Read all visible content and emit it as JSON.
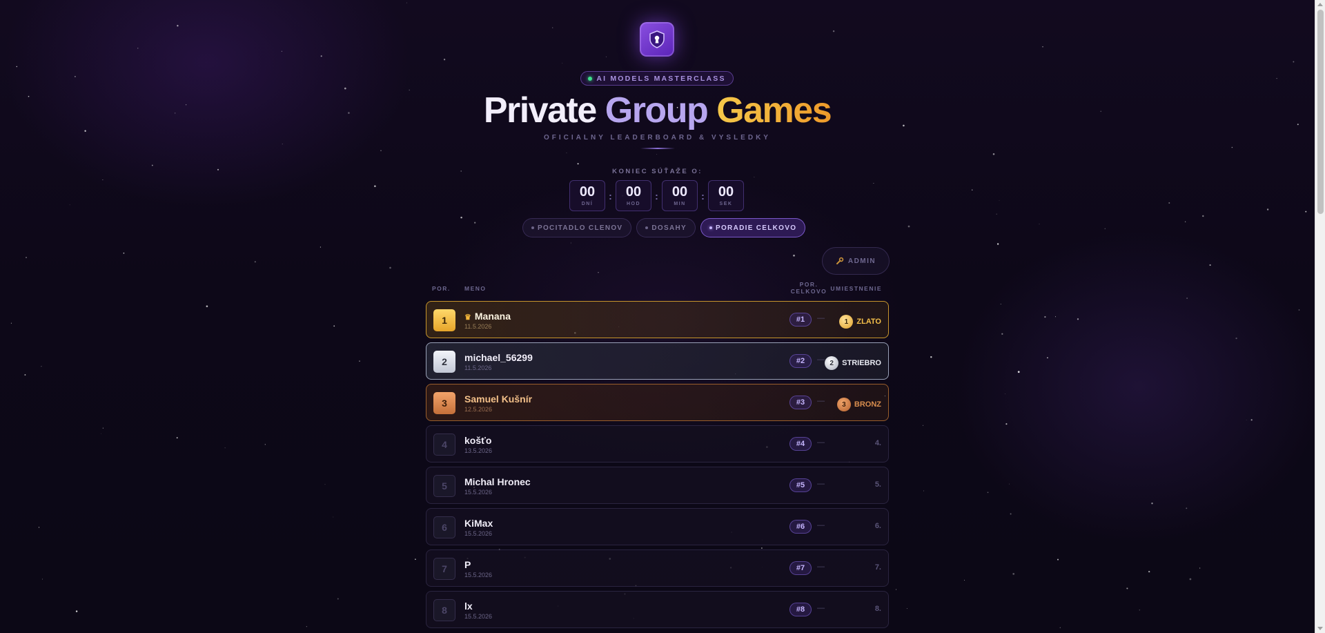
{
  "header": {
    "badge": "AI MODELS MASTERCLASS",
    "title_part1": "Private",
    "title_part2": "Group",
    "title_part3": "Games",
    "subtitle": "OFICIALNY LEADERBOARD & VYSLEDKY"
  },
  "countdown": {
    "label": "KONIEC SÚŤAŽE O:",
    "separator": ":",
    "units": [
      {
        "value": "00",
        "label": "DNÍ"
      },
      {
        "value": "00",
        "label": "HOD"
      },
      {
        "value": "00",
        "label": "MIN"
      },
      {
        "value": "00",
        "label": "SEK"
      }
    ]
  },
  "tabs": [
    {
      "label": "POCITADLO CLENOV",
      "active": false
    },
    {
      "label": "DOSAHY",
      "active": false
    },
    {
      "label": "PORADIE CELKOVO",
      "active": true
    }
  ],
  "admin_button": {
    "label": "ADMIN",
    "icon": "wrench-icon"
  },
  "table": {
    "headers": {
      "rank": "POR.",
      "name": "MENO",
      "overall_line1": "POR.",
      "overall_line2": "CELKOVO",
      "placement": "UMIESTNENIE"
    },
    "rows": [
      {
        "rank": "1",
        "name": "Manana",
        "crown": true,
        "date": "11.5.2026",
        "overall": "#1",
        "dash": "—",
        "medal": "1",
        "placement": "ZLATO",
        "tier": "gold"
      },
      {
        "rank": "2",
        "name": "michael_56299",
        "crown": false,
        "date": "11.5.2026",
        "overall": "#2",
        "dash": "—",
        "medal": "2",
        "placement": "STRIEBRO",
        "tier": "silver"
      },
      {
        "rank": "3",
        "name": "Samuel Kušnír",
        "crown": false,
        "date": "12.5.2026",
        "overall": "#3",
        "dash": "—",
        "medal": "3",
        "placement": "BRONZ",
        "tier": "bronze"
      },
      {
        "rank": "4",
        "name": "košťo",
        "crown": false,
        "date": "13.5.2026",
        "overall": "#4",
        "dash": "—",
        "medal": "",
        "placement": "4.",
        "tier": "plain"
      },
      {
        "rank": "5",
        "name": "Michal Hronec",
        "crown": false,
        "date": "15.5.2026",
        "overall": "#5",
        "dash": "—",
        "medal": "",
        "placement": "5.",
        "tier": "plain"
      },
      {
        "rank": "6",
        "name": "KiMax",
        "crown": false,
        "date": "15.5.2026",
        "overall": "#6",
        "dash": "—",
        "medal": "",
        "placement": "6.",
        "tier": "plain"
      },
      {
        "rank": "7",
        "name": "P",
        "crown": false,
        "date": "15.5.2026",
        "overall": "#7",
        "dash": "—",
        "medal": "",
        "placement": "7.",
        "tier": "plain"
      },
      {
        "rank": "8",
        "name": "lx",
        "crown": false,
        "date": "15.5.2026",
        "overall": "#8",
        "dash": "—",
        "medal": "",
        "placement": "8.",
        "tier": "plain"
      }
    ]
  },
  "colors": {
    "accent": "#8a4fe0",
    "gold": "#f5c04a",
    "silver": "#e8eaf2",
    "bronze": "#d98e4e",
    "online_dot": "#3fe08b"
  }
}
